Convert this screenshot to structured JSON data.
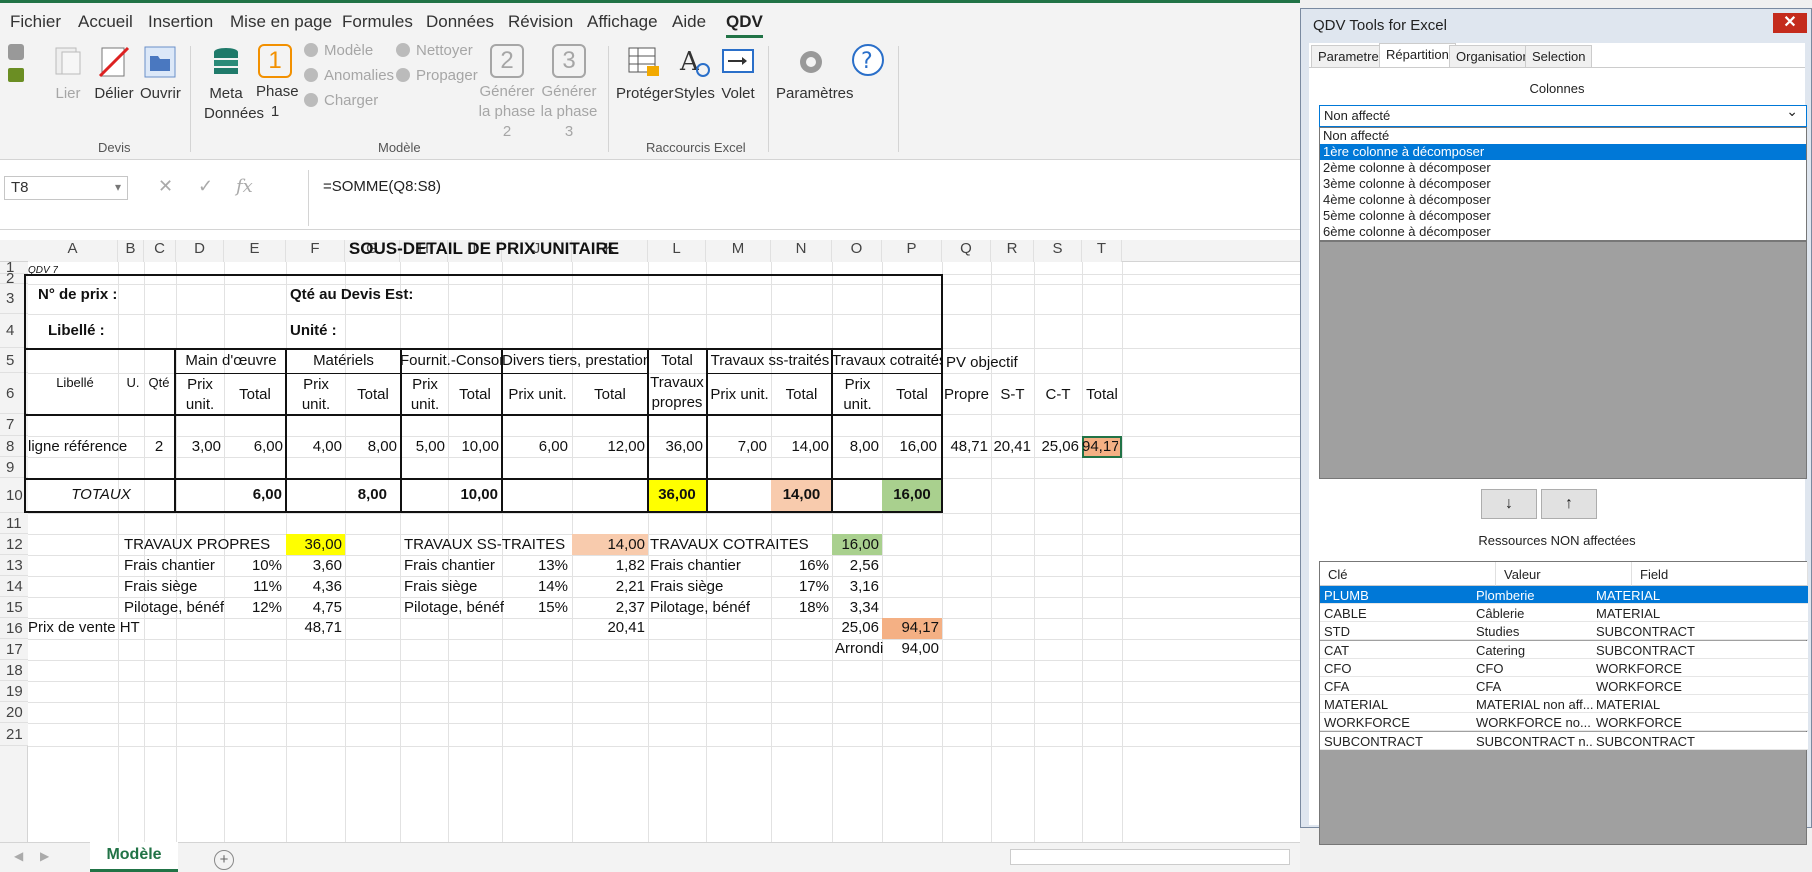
{
  "ribbon": {
    "tabs": [
      "Fichier",
      "Accueil",
      "Insertion",
      "Mise en page",
      "Formules",
      "Données",
      "Révision",
      "Affichage",
      "Aide",
      "QDV"
    ],
    "active_tab": "QDV",
    "devis": {
      "lier": "Lier",
      "delier": "Délier",
      "ouvrir": "Ouvrir",
      "group": "Devis"
    },
    "modele": {
      "meta1": "Meta",
      "meta2": "Données",
      "phase_num": "1",
      "phase1": "Phase",
      "phase2": "1",
      "modele": "Modèle",
      "anomalies": "Anomalies",
      "charger": "Charger",
      "nettoyer": "Nettoyer",
      "propager": "Propager",
      "gen2_num": "2",
      "gen2_a": "Générer",
      "gen2_b": "la phase 2",
      "gen3_num": "3",
      "gen3_a": "Générer",
      "gen3_b": "la phase 3",
      "group": "Modèle"
    },
    "raccourcis": {
      "proteger": "Protéger",
      "styles": "Styles",
      "volet": "Volet",
      "group": "Raccourcis Excel"
    },
    "parametres": "Paramètres"
  },
  "formula_bar": {
    "cell": "T8",
    "fx": "fx",
    "formula": "=SOMME(Q8:S8)"
  },
  "columns": [
    "A",
    "B",
    "C",
    "D",
    "E",
    "F",
    "G",
    "H",
    "I",
    "J",
    "K",
    "L",
    "M",
    "N",
    "O",
    "P",
    "Q",
    "R",
    "S",
    "T"
  ],
  "rows": [
    "1",
    "2",
    "3",
    "4",
    "5",
    "6",
    "7",
    "8",
    "9",
    "10",
    "11",
    "12",
    "13",
    "14",
    "15",
    "16",
    "17",
    "18",
    "19",
    "20",
    "21"
  ],
  "sheet": {
    "title": "SOUS-DETAIL DE PRIX UNITAIRE",
    "qdv": "QDV 7",
    "no_prix": "N° de prix :",
    "qte_devis": "Qté au Devis Est:",
    "libelle_lbl": "Libellé :",
    "unite": "Unité :",
    "h_libelle": "Libellé",
    "h_u": "U.",
    "h_qte": "Qté",
    "h_mo": "Main d'œuvre",
    "h_mat": "Matériels",
    "h_fourn": "Fournit.-Consom",
    "h_divers": "Divers tiers, prestations",
    "h_total_tp1": "Total",
    "h_total_tp2": "Travaux",
    "h_total_tp3": "propres",
    "h_ss": "Travaux ss-traités",
    "h_cot": "Travaux cotraités",
    "h_pv": "PV objectif",
    "prix1": "Prix",
    "prix2": "unit.",
    "total": "Total",
    "prixunit": "Prix unit.",
    "propre": "Propre",
    "st": "S-T",
    "ct": "C-T",
    "row8": [
      "ligne référence",
      "2",
      "3,00",
      "6,00",
      "4,00",
      "8,00",
      "5,00",
      "10,00",
      "6,00",
      "12,00",
      "36,00",
      "7,00",
      "14,00",
      "8,00",
      "16,00",
      "48,71",
      "20,41",
      "25,06",
      "94,17"
    ],
    "totaux": "TOTAUX",
    "tot": [
      "6,00",
      "8,00",
      "10,00",
      "36,00",
      "14,00",
      "16,00"
    ],
    "s1": {
      "t": "TRAVAUX PROPRES",
      "v": "36,00",
      "r1": "Frais chantier",
      "p1": "10%",
      "v1": "3,60",
      "r2": "Frais siège",
      "p2": "11%",
      "v2": "4,36",
      "r3": "Pilotage, bénéfi",
      "p3": "12%",
      "v3": "4,75"
    },
    "s2": {
      "t": "TRAVAUX SS-TRAITES",
      "v": "14,00",
      "r1": "Frais chantier",
      "p1": "13%",
      "v1": "1,82",
      "r2": "Frais siège",
      "p2": "14%",
      "v2": "2,21",
      "r3": "Pilotage, bénéfi",
      "p3": "15%",
      "v3": "2,37"
    },
    "s3": {
      "t": "TRAVAUX COTRAITES",
      "v": "16,00",
      "r1": "Frais chantier",
      "p1": "16%",
      "v1": "2,56",
      "r2": "Frais siège",
      "p2": "17%",
      "v2": "3,16",
      "r3": "Pilotage, bénéfice",
      "p3": "18%",
      "v3": "3,34"
    },
    "pv_label": "Prix de vente HT",
    "pv1": "48,71",
    "pv2": "20,41",
    "pv3": "25,06",
    "pvt": "94,17",
    "arrondi": "Arrondi",
    "arrondi_v": "94,00"
  },
  "sheet_tab": "Modèle",
  "panel": {
    "title": "QDV Tools for Excel",
    "close": "✕",
    "tabs": [
      "Parametres",
      "Répartition",
      "Organisation",
      "Selection"
    ],
    "active_tab": "Répartition",
    "colonnes": "Colonnes",
    "combo_value": "Non affecté",
    "options": [
      "Non affecté",
      "1ère colonne à décomposer",
      "2ème colonne à décomposer",
      "3ème colonne à décomposer",
      "4ème colonne à décomposer",
      "5ème colonne à décomposer",
      "6ème colonne à décomposer"
    ],
    "selected_option": "1ère colonne à décomposer",
    "down": "↓",
    "up": "↑",
    "ressources": "Ressources NON affectées",
    "headers": [
      "Clé",
      "Valeur",
      "Field"
    ],
    "rows": [
      [
        "PLUMB",
        "Plomberie",
        "MATERIAL"
      ],
      [
        "CABLE",
        "Câblerie",
        "MATERIAL"
      ],
      [
        "STD",
        "Studies",
        "SUBCONTRACT"
      ],
      [
        "CAT",
        "Catering",
        "SUBCONTRACT"
      ],
      [
        "CFO",
        "CFO",
        "WORKFORCE"
      ],
      [
        "CFA",
        "CFA",
        "WORKFORCE"
      ],
      [
        "MATERIAL",
        "MATERIAL non aff...",
        "MATERIAL"
      ],
      [
        "WORKFORCE",
        "WORKFORCE no...",
        "WORKFORCE"
      ],
      [
        "SUBCONTRACT",
        "SUBCONTRACT n...",
        "SUBCONTRACT"
      ]
    ]
  },
  "colors": {
    "excel_green": "#217346",
    "yellow": "#ffff00",
    "peach": "#f8cbad",
    "green": "#a9d08e",
    "orange": "#f4b084",
    "select_blue": "#0078d7"
  }
}
